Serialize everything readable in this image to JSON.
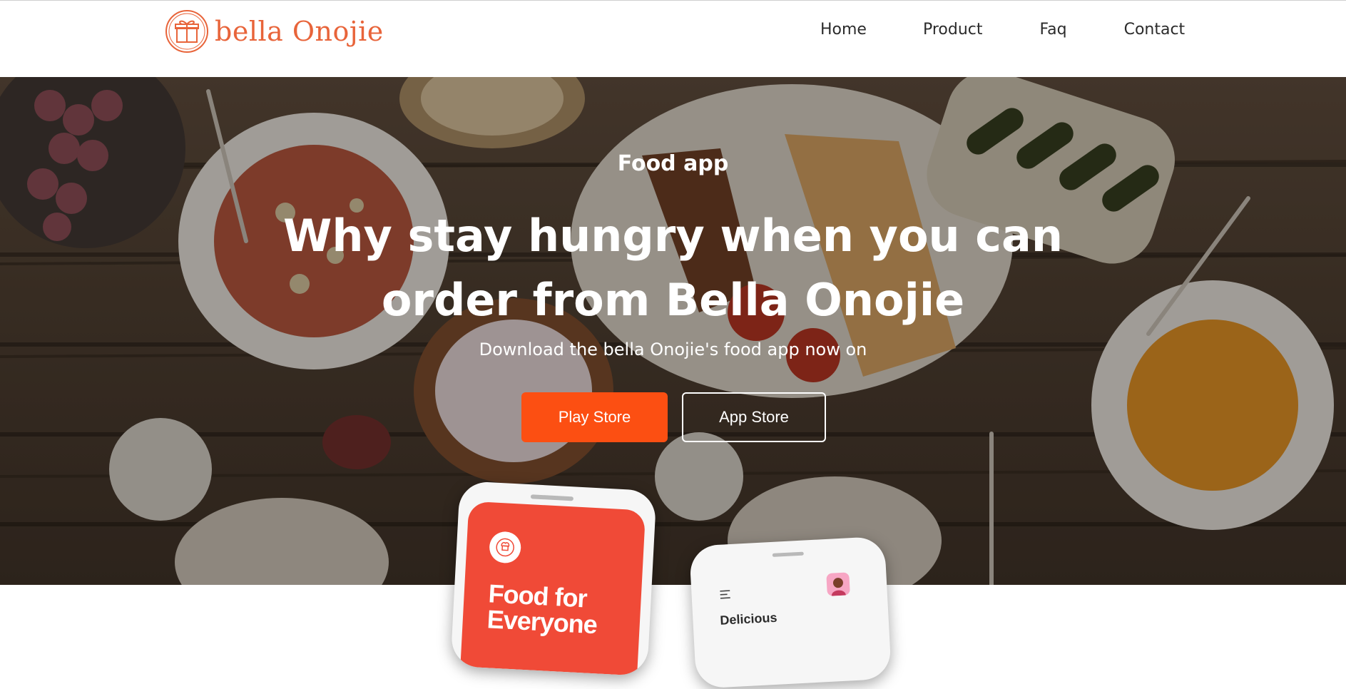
{
  "brand": {
    "name": "bella Onojie",
    "accent_color": "#e8643a",
    "logo_icon": "gift-box-logo-icon"
  },
  "nav": {
    "items": [
      {
        "label": "Home"
      },
      {
        "label": "Product"
      },
      {
        "label": "Faq"
      },
      {
        "label": "Contact"
      }
    ]
  },
  "hero": {
    "eyebrow": "Food app",
    "headline_line1": "Why stay hungry when you can",
    "headline_line2": "order from Bella Onojie",
    "subtext": "Download the bella Onojie's food app now on",
    "buttons": {
      "play_store": "Play Store",
      "app_store": "App Store"
    },
    "primary_button_color": "#fc4f12",
    "background_image": "food-table-photo"
  },
  "phones": {
    "phone1_tagline": "Food for Everyone",
    "phone1_badge_icon": "chef-hat-icon",
    "phone2_title": "Delicious",
    "phone2_menu_icon": "hamburger-menu-icon",
    "phone2_avatar_icon": "user-avatar-icon"
  }
}
